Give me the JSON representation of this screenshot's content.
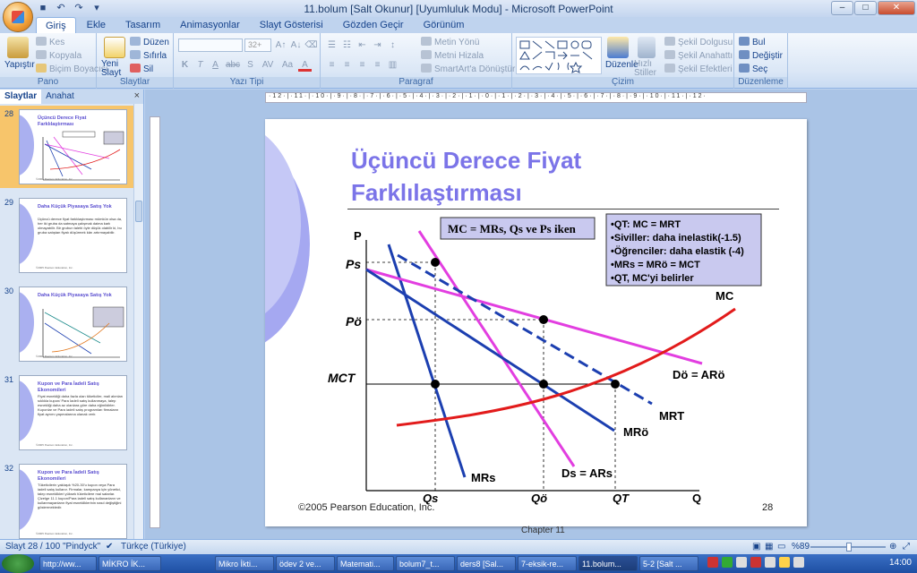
{
  "window": {
    "title": "11.bolum [Salt Okunur] [Uyumluluk Modu] - Microsoft PowerPoint",
    "controls": [
      "–",
      "□",
      "✕"
    ]
  },
  "ribbon_tabs": [
    "Giriş",
    "Ekle",
    "Tasarım",
    "Animasyonlar",
    "Slayt Gösterisi",
    "Gözden Geçir",
    "Görünüm"
  ],
  "ribbon": {
    "pano": {
      "label": "Pano",
      "yapistir": "Yapıştır",
      "kes": "Kes",
      "kopyala": "Kopyala",
      "bicim": "Biçim Boyacısı"
    },
    "slaytlar": {
      "label": "Slaytlar",
      "yeni": "Yeni Slayt",
      "duzen": "Düzen",
      "sifirla": "Sıfırla",
      "sil": "Sil"
    },
    "yazi": {
      "label": "Yazı Tipi",
      "size": "32+",
      "fmt": [
        "K",
        "T",
        "A",
        "abc",
        "S",
        "AV",
        "Aa",
        "A"
      ]
    },
    "paragraf": {
      "label": "Paragraf",
      "metin_yonu": "Metin Yönü",
      "metni_hizala": "Metni Hizala",
      "smartart": "SmartArt'a Dönüştür"
    },
    "cizim": {
      "label": "Çizim",
      "duzenle": "Düzenle",
      "hizli": "Hızlı Stiller",
      "dolgu": "Şekil Dolgusu",
      "anahat": "Şekil Anahattı",
      "efekt": "Şekil Efektleri"
    },
    "duzenleme": {
      "label": "Düzenleme",
      "bul": "Bul",
      "degistir": "Değiştir",
      "sec": "Seç"
    }
  },
  "panel": {
    "tabs": [
      "Slaytlar",
      "Anahat"
    ],
    "close": "×",
    "thumbs": [
      {
        "num": "28",
        "title": "Üçüncü Derece Fiyat Farklılaştırması",
        "body": "",
        "selected": true
      },
      {
        "num": "29",
        "title": "Daha Küçük Piyasaya Satış Yok",
        "body": "Üçüncü derece fiyat farklılaştırması mümkün olsa da, her iki gruba da satmaya çalışmak daima karlı olmayabilir. Bir grubun talebi öyle düşük olabilir ki, bu gruba satıştan fiyatı düşürmek kârı artırmayabilir.",
        "selected": false
      },
      {
        "num": "30",
        "title": "Daha Küçük Piyasaya Satış Yok",
        "body": "",
        "selected": false
      },
      {
        "num": "31",
        "title": "Kupon ve Para İadeli Satış Ekonomileri",
        "body": "Fiyat esnekliği daha fazla olan tüketiciler, mali alımları sıklıkla kupon/ Para İadeli satış kullanmaya, talep esnekliği daha az olanlara göre daha eğimlidirler. Kuponlar ve Para iadeli satış programları firmaların fiyat ayrımı yapmalarına olanak verir.",
        "selected": false
      },
      {
        "num": "32",
        "title": "Kupon ve Para İadeli Satış Ekonomileri",
        "body": "Tüketicilerin yaklaşık %20-30'u kupon veya Para iadeli satış kullanır. Firmalar, kampanya için yönetici, talep esneklikleri yüksek tüketicilere mal satarlar. Çizelge 11.1 kupon/Para iadeli satış kullananların ve kullanmayanların fiyat esnekliklerinin nasıl değiştiğini göstermektedir.",
        "selected": false
      }
    ]
  },
  "ruler_text": "·12·|·11·|·10·|·9·|·8·|·7·|·6·|·5·|·4·|·3·|·2·|·1·|·0·|·1·|·2·|·3·|·4·|·5·|·6·|·7·|·8·|·9·|·10·|·11·|·12·",
  "slide": {
    "title": "Üçüncü Derece Fiyat Farklılaştırması",
    "copyright": "©2005 Pearson Education, Inc.",
    "page": "28",
    "chapter": "Chapter 11"
  },
  "chart_data": {
    "type": "line",
    "box_label": "MC = MRs, Qs ve Ps iken",
    "info_lines": [
      "•QT: MC = MRT",
      "•Siviller: daha inelastik(-1.5)",
      "•Öğrenciler: daha elastik (-4)",
      "•MRs = MRö = MCT",
      "•QT, MC'yi belirler"
    ],
    "axis_labels": {
      "y": "P",
      "x": "Q"
    },
    "y_ticks": [
      "Ps",
      "Pö",
      "MCT"
    ],
    "x_ticks": [
      "Qs",
      "Qö",
      "QT"
    ],
    "series": [
      {
        "name": "MRs",
        "color": "#1c3fb0"
      },
      {
        "name": "Ds = ARs",
        "color": "#e23ee0"
      },
      {
        "name": "Dö = ARö",
        "color": "#e23ee0"
      },
      {
        "name": "MRö",
        "color": "#1c3fb0"
      },
      {
        "name": "MRT",
        "color": "#1c3fb0"
      },
      {
        "name": "MC",
        "color": "#e21b1b"
      }
    ]
  },
  "statusbar": {
    "slide": "Slayt 28 / 100",
    "theme": "\"Pindyck\"",
    "lang": "Türkçe (Türkiye)",
    "zoom": "%89"
  },
  "taskbar": {
    "items": [
      "http://ww...",
      "MİKRO İK...",
      "Mikro İkti...",
      "ödev 2 ve...",
      "Matemati...",
      "bolum7_t...",
      "ders8 [Sal...",
      "7-eksik-re...",
      "11.bolum...",
      "5-2 [Salt ..."
    ],
    "clock": "14:00"
  }
}
